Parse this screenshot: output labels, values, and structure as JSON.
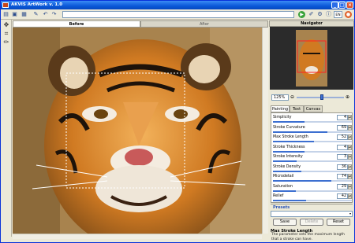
{
  "window": {
    "title": "AKVIS ArtWork v. 1.0"
  },
  "toolbar": {
    "icons": [
      "open-icon",
      "save-icon",
      "print-icon",
      "brush-icon",
      "undo-icon",
      "redo-icon"
    ],
    "right_icons": [
      "run-icon",
      "tag-icon",
      "preferences-icon",
      "info-icon",
      "help-icon",
      "lang-icon",
      "stop-icon"
    ],
    "lang_label": "EN"
  },
  "view_tabs": {
    "before": "Before",
    "after": "After",
    "active": "before"
  },
  "navigator": {
    "title": "Navigator",
    "zoom": "125%"
  },
  "settings_tabs": {
    "painting": "Painting",
    "text": "Text",
    "canvas": "Canvas",
    "active": "painting"
  },
  "params": [
    {
      "label": "Simplicity",
      "value": "4",
      "level": 0.4
    },
    {
      "label": "Stroke Curvature",
      "value": "69",
      "level": 0.69
    },
    {
      "label": "Max Stroke Length",
      "value": "52",
      "level": 0.52
    },
    {
      "label": "Stroke Thickness",
      "value": "4",
      "level": 0.4
    },
    {
      "label": "Stroke Intensity",
      "value": "3",
      "level": 0.3
    },
    {
      "label": "Stroke Density",
      "value": "36",
      "level": 0.36
    },
    {
      "label": "Microdetail",
      "value": "74",
      "level": 0.74
    },
    {
      "label": "Saturation",
      "value": "29",
      "level": 0.29
    },
    {
      "label": "Relief",
      "value": "42",
      "level": 0.42
    }
  ],
  "presets": {
    "title": "Presets",
    "save": "Save",
    "delete": "Delete",
    "reset": "Reset"
  },
  "help": {
    "title": "Max Stroke Length",
    "text": "The parameter sets the maximum length that a stroke can have."
  },
  "colors": {
    "title_bar": "#0a58d8",
    "accent": "#3c6fd0",
    "window_bg": "#ece9d8"
  }
}
